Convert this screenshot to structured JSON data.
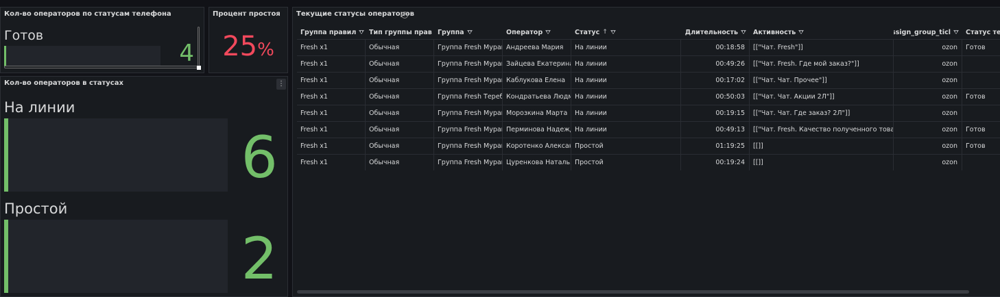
{
  "panel_phone_status": {
    "title": "Кол-во операторов по статусам телефона",
    "items": [
      {
        "label": "Готов",
        "value": "4"
      }
    ]
  },
  "panel_idle_percent": {
    "title": "Процент простоя",
    "value": "25",
    "unit": "%",
    "color": "#f2495c"
  },
  "panel_status_counts": {
    "title": "Кол-во операторов в статусах",
    "menu_icon": "vertical-dots-icon",
    "items": [
      {
        "label": "На линии",
        "value": "6"
      },
      {
        "label": "Простой",
        "value": "2"
      }
    ],
    "color": "#73bf69"
  },
  "table_panel": {
    "title": "Текущие статусы операторов",
    "info_icon": "info-circle-icon",
    "columns": [
      "Группа правил",
      "Тип группы прав",
      "Группа",
      "Оператор",
      "Статус",
      "Длительность",
      "Активность",
      "assign_group_ticl",
      "Статус теле"
    ],
    "sorted_column": "Статус",
    "sort_direction": "ascending",
    "rows": [
      [
        "Fresh x1",
        "Обычная",
        "Группа Fresh Мураш",
        "Андреева Мария",
        "На линии",
        "00:18:58",
        "[[\"Чат. Fresh\"]]",
        "ozon",
        "Готов"
      ],
      [
        "Fresh x1",
        "Обычная",
        "Группа Fresh Мураш",
        "Зайцева Екатерина",
        "На линии",
        "00:49:26",
        "[[\"Чат. Fresh. Где мой заказ?\"]]",
        "ozon",
        ""
      ],
      [
        "Fresh x1",
        "Обычная",
        "Группа Fresh Мураш",
        "Каблукова Елена",
        "На линии",
        "00:17:02",
        "[[\"Чат. Чат. Прочее\"]]",
        "ozon",
        ""
      ],
      [
        "Fresh x1",
        "Обычная",
        "Группа Fresh Теребе",
        "Кондратьева Людми",
        "На линии",
        "00:50:03",
        "[[\"Чат. Чат. Акции 2Л\"]]",
        "ozon",
        "Готов"
      ],
      [
        "Fresh x1",
        "Обычная",
        "Группа Fresh Мураш",
        "Морозкина Марта",
        "На линии",
        "00:19:15",
        "[[\"Чат. Чат. Где заказ? 2Л\"]]",
        "ozon",
        ""
      ],
      [
        "Fresh x1",
        "Обычная",
        "Группа Fresh Мураш",
        "Перминова Надежда",
        "На линии",
        "00:49:13",
        "[[\"Чат. Fresh. Качество полученного товара",
        "ozon",
        "Готов"
      ],
      [
        "Fresh x1",
        "Обычная",
        "Группа Fresh Мураш",
        "Коротенко Александ",
        "Простой",
        "01:19:25",
        "[[]]",
        "ozon",
        "Готов"
      ],
      [
        "Fresh x1",
        "Обычная",
        "Группа Fresh Мураш",
        "Цуренкова Наталья",
        "Простой",
        "00:19:24",
        "[[]]",
        "ozon",
        ""
      ]
    ]
  }
}
